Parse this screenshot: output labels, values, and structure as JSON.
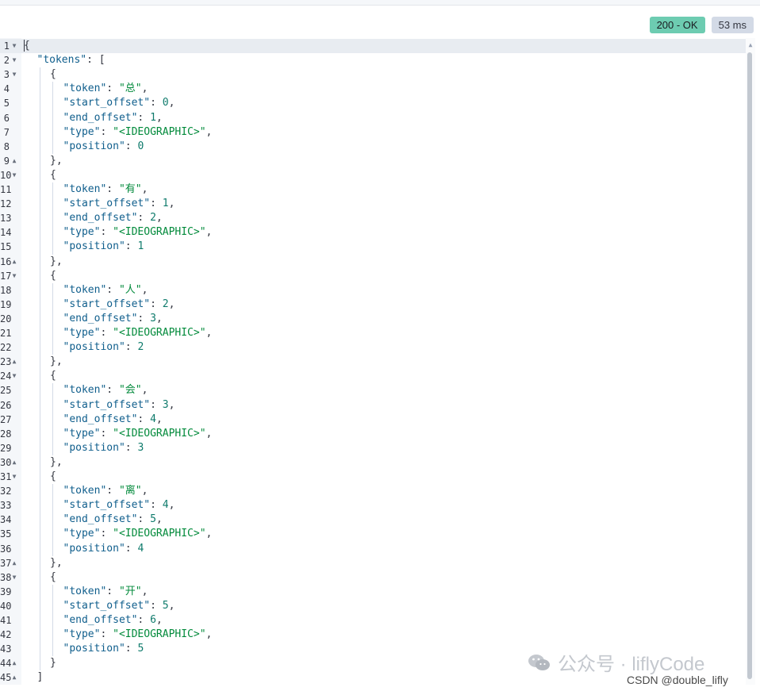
{
  "status": {
    "code_label": "200 - OK",
    "time_label": "53 ms",
    "ok_color": "#6dccb1"
  },
  "editor": {
    "language": "json",
    "lines": [
      {
        "num": "1",
        "fold": "down",
        "indent": 0,
        "parts": [
          [
            "p",
            "{"
          ]
        ]
      },
      {
        "num": "2",
        "fold": "down",
        "indent": 1,
        "parts": [
          [
            "k",
            "\"tokens\""
          ],
          [
            "p",
            ": ["
          ]
        ]
      },
      {
        "num": "3",
        "fold": "down",
        "indent": 2,
        "parts": [
          [
            "p",
            "{"
          ]
        ]
      },
      {
        "num": "4",
        "fold": "",
        "indent": 3,
        "parts": [
          [
            "k",
            "\"token\""
          ],
          [
            "p",
            ": "
          ],
          [
            "s",
            "\"总\""
          ],
          [
            "p",
            ","
          ]
        ]
      },
      {
        "num": "5",
        "fold": "",
        "indent": 3,
        "parts": [
          [
            "k",
            "\"start_offset\""
          ],
          [
            "p",
            ": "
          ],
          [
            "n",
            "0"
          ],
          [
            "p",
            ","
          ]
        ]
      },
      {
        "num": "6",
        "fold": "",
        "indent": 3,
        "parts": [
          [
            "k",
            "\"end_offset\""
          ],
          [
            "p",
            ": "
          ],
          [
            "n",
            "1"
          ],
          [
            "p",
            ","
          ]
        ]
      },
      {
        "num": "7",
        "fold": "",
        "indent": 3,
        "parts": [
          [
            "k",
            "\"type\""
          ],
          [
            "p",
            ": "
          ],
          [
            "s",
            "\"<IDEOGRAPHIC>\""
          ],
          [
            "p",
            ","
          ]
        ]
      },
      {
        "num": "8",
        "fold": "",
        "indent": 3,
        "parts": [
          [
            "k",
            "\"position\""
          ],
          [
            "p",
            ": "
          ],
          [
            "n",
            "0"
          ]
        ]
      },
      {
        "num": "9",
        "fold": "up",
        "indent": 2,
        "parts": [
          [
            "p",
            "},"
          ]
        ]
      },
      {
        "num": "10",
        "fold": "down",
        "indent": 2,
        "parts": [
          [
            "p",
            "{"
          ]
        ]
      },
      {
        "num": "11",
        "fold": "",
        "indent": 3,
        "parts": [
          [
            "k",
            "\"token\""
          ],
          [
            "p",
            ": "
          ],
          [
            "s",
            "\"有\""
          ],
          [
            "p",
            ","
          ]
        ]
      },
      {
        "num": "12",
        "fold": "",
        "indent": 3,
        "parts": [
          [
            "k",
            "\"start_offset\""
          ],
          [
            "p",
            ": "
          ],
          [
            "n",
            "1"
          ],
          [
            "p",
            ","
          ]
        ]
      },
      {
        "num": "13",
        "fold": "",
        "indent": 3,
        "parts": [
          [
            "k",
            "\"end_offset\""
          ],
          [
            "p",
            ": "
          ],
          [
            "n",
            "2"
          ],
          [
            "p",
            ","
          ]
        ]
      },
      {
        "num": "14",
        "fold": "",
        "indent": 3,
        "parts": [
          [
            "k",
            "\"type\""
          ],
          [
            "p",
            ": "
          ],
          [
            "s",
            "\"<IDEOGRAPHIC>\""
          ],
          [
            "p",
            ","
          ]
        ]
      },
      {
        "num": "15",
        "fold": "",
        "indent": 3,
        "parts": [
          [
            "k",
            "\"position\""
          ],
          [
            "p",
            ": "
          ],
          [
            "n",
            "1"
          ]
        ]
      },
      {
        "num": "16",
        "fold": "up",
        "indent": 2,
        "parts": [
          [
            "p",
            "},"
          ]
        ]
      },
      {
        "num": "17",
        "fold": "down",
        "indent": 2,
        "parts": [
          [
            "p",
            "{"
          ]
        ]
      },
      {
        "num": "18",
        "fold": "",
        "indent": 3,
        "parts": [
          [
            "k",
            "\"token\""
          ],
          [
            "p",
            ": "
          ],
          [
            "s",
            "\"人\""
          ],
          [
            "p",
            ","
          ]
        ]
      },
      {
        "num": "19",
        "fold": "",
        "indent": 3,
        "parts": [
          [
            "k",
            "\"start_offset\""
          ],
          [
            "p",
            ": "
          ],
          [
            "n",
            "2"
          ],
          [
            "p",
            ","
          ]
        ]
      },
      {
        "num": "20",
        "fold": "",
        "indent": 3,
        "parts": [
          [
            "k",
            "\"end_offset\""
          ],
          [
            "p",
            ": "
          ],
          [
            "n",
            "3"
          ],
          [
            "p",
            ","
          ]
        ]
      },
      {
        "num": "21",
        "fold": "",
        "indent": 3,
        "parts": [
          [
            "k",
            "\"type\""
          ],
          [
            "p",
            ": "
          ],
          [
            "s",
            "\"<IDEOGRAPHIC>\""
          ],
          [
            "p",
            ","
          ]
        ]
      },
      {
        "num": "22",
        "fold": "",
        "indent": 3,
        "parts": [
          [
            "k",
            "\"position\""
          ],
          [
            "p",
            ": "
          ],
          [
            "n",
            "2"
          ]
        ]
      },
      {
        "num": "23",
        "fold": "up",
        "indent": 2,
        "parts": [
          [
            "p",
            "},"
          ]
        ]
      },
      {
        "num": "24",
        "fold": "down",
        "indent": 2,
        "parts": [
          [
            "p",
            "{"
          ]
        ]
      },
      {
        "num": "25",
        "fold": "",
        "indent": 3,
        "parts": [
          [
            "k",
            "\"token\""
          ],
          [
            "p",
            ": "
          ],
          [
            "s",
            "\"会\""
          ],
          [
            "p",
            ","
          ]
        ]
      },
      {
        "num": "26",
        "fold": "",
        "indent": 3,
        "parts": [
          [
            "k",
            "\"start_offset\""
          ],
          [
            "p",
            ": "
          ],
          [
            "n",
            "3"
          ],
          [
            "p",
            ","
          ]
        ]
      },
      {
        "num": "27",
        "fold": "",
        "indent": 3,
        "parts": [
          [
            "k",
            "\"end_offset\""
          ],
          [
            "p",
            ": "
          ],
          [
            "n",
            "4"
          ],
          [
            "p",
            ","
          ]
        ]
      },
      {
        "num": "28",
        "fold": "",
        "indent": 3,
        "parts": [
          [
            "k",
            "\"type\""
          ],
          [
            "p",
            ": "
          ],
          [
            "s",
            "\"<IDEOGRAPHIC>\""
          ],
          [
            "p",
            ","
          ]
        ]
      },
      {
        "num": "29",
        "fold": "",
        "indent": 3,
        "parts": [
          [
            "k",
            "\"position\""
          ],
          [
            "p",
            ": "
          ],
          [
            "n",
            "3"
          ]
        ]
      },
      {
        "num": "30",
        "fold": "up",
        "indent": 2,
        "parts": [
          [
            "p",
            "},"
          ]
        ]
      },
      {
        "num": "31",
        "fold": "down",
        "indent": 2,
        "parts": [
          [
            "p",
            "{"
          ]
        ]
      },
      {
        "num": "32",
        "fold": "",
        "indent": 3,
        "parts": [
          [
            "k",
            "\"token\""
          ],
          [
            "p",
            ": "
          ],
          [
            "s",
            "\"离\""
          ],
          [
            "p",
            ","
          ]
        ]
      },
      {
        "num": "33",
        "fold": "",
        "indent": 3,
        "parts": [
          [
            "k",
            "\"start_offset\""
          ],
          [
            "p",
            ": "
          ],
          [
            "n",
            "4"
          ],
          [
            "p",
            ","
          ]
        ]
      },
      {
        "num": "34",
        "fold": "",
        "indent": 3,
        "parts": [
          [
            "k",
            "\"end_offset\""
          ],
          [
            "p",
            ": "
          ],
          [
            "n",
            "5"
          ],
          [
            "p",
            ","
          ]
        ]
      },
      {
        "num": "35",
        "fold": "",
        "indent": 3,
        "parts": [
          [
            "k",
            "\"type\""
          ],
          [
            "p",
            ": "
          ],
          [
            "s",
            "\"<IDEOGRAPHIC>\""
          ],
          [
            "p",
            ","
          ]
        ]
      },
      {
        "num": "36",
        "fold": "",
        "indent": 3,
        "parts": [
          [
            "k",
            "\"position\""
          ],
          [
            "p",
            ": "
          ],
          [
            "n",
            "4"
          ]
        ]
      },
      {
        "num": "37",
        "fold": "up",
        "indent": 2,
        "parts": [
          [
            "p",
            "},"
          ]
        ]
      },
      {
        "num": "38",
        "fold": "down",
        "indent": 2,
        "parts": [
          [
            "p",
            "{"
          ]
        ]
      },
      {
        "num": "39",
        "fold": "",
        "indent": 3,
        "parts": [
          [
            "k",
            "\"token\""
          ],
          [
            "p",
            ": "
          ],
          [
            "s",
            "\"开\""
          ],
          [
            "p",
            ","
          ]
        ]
      },
      {
        "num": "40",
        "fold": "",
        "indent": 3,
        "parts": [
          [
            "k",
            "\"start_offset\""
          ],
          [
            "p",
            ": "
          ],
          [
            "n",
            "5"
          ],
          [
            "p",
            ","
          ]
        ]
      },
      {
        "num": "41",
        "fold": "",
        "indent": 3,
        "parts": [
          [
            "k",
            "\"end_offset\""
          ],
          [
            "p",
            ": "
          ],
          [
            "n",
            "6"
          ],
          [
            "p",
            ","
          ]
        ]
      },
      {
        "num": "42",
        "fold": "",
        "indent": 3,
        "parts": [
          [
            "k",
            "\"type\""
          ],
          [
            "p",
            ": "
          ],
          [
            "s",
            "\"<IDEOGRAPHIC>\""
          ],
          [
            "p",
            ","
          ]
        ]
      },
      {
        "num": "43",
        "fold": "",
        "indent": 3,
        "parts": [
          [
            "k",
            "\"position\""
          ],
          [
            "p",
            ": "
          ],
          [
            "n",
            "5"
          ]
        ]
      },
      {
        "num": "44",
        "fold": "up",
        "indent": 2,
        "parts": [
          [
            "p",
            "}"
          ]
        ]
      },
      {
        "num": "45",
        "fold": "up",
        "indent": 1,
        "parts": [
          [
            "p",
            "]"
          ]
        ]
      }
    ]
  },
  "watermark": {
    "text": "公众号 · liflyCode",
    "icon": "wechat-icon"
  },
  "credit": "CSDN @double_lifly"
}
